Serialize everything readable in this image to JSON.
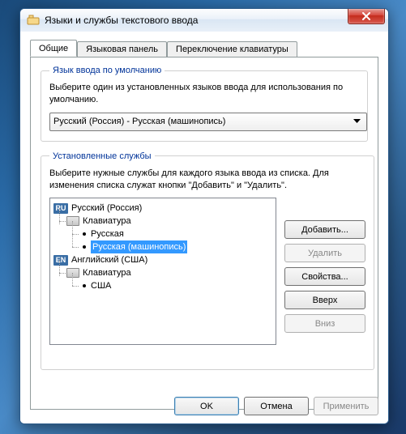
{
  "window": {
    "title": "Языки и службы текстового ввода"
  },
  "tabs": {
    "general": "Общие",
    "lang_panel": "Языковая панель",
    "switch": "Переключение клавиатуры"
  },
  "default_group": {
    "legend": "Язык ввода по умолчанию",
    "desc": "Выберите один из установленных языков ввода для использования по умолчанию.",
    "selected": "Русский (Россия) - Русская (машинопись)"
  },
  "installed_group": {
    "legend": "Установленные службы",
    "desc": "Выберите нужные службы для каждого языка ввода из списка. Для изменения списка служат кнопки \"Добавить\" и \"Удалить\"."
  },
  "tree": {
    "ru_badge": "RU",
    "ru_lang": "Русский (Россия)",
    "keyboard_label": "Клавиатура",
    "ru_layout1": "Русская",
    "ru_layout2": "Русская (машинопись)",
    "en_badge": "EN",
    "en_lang": "Английский (США)",
    "en_layout1": "США"
  },
  "buttons": {
    "add": "Добавить...",
    "remove": "Удалить",
    "props": "Свойства...",
    "up": "Вверх",
    "down": "Вниз",
    "ok": "OK",
    "cancel": "Отмена",
    "apply": "Применить"
  }
}
